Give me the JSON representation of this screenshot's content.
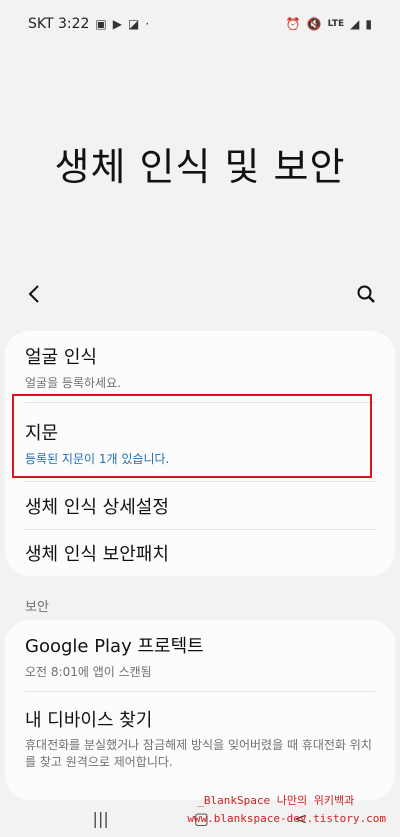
{
  "status_bar": {
    "carrier_time": "SKT 3:22",
    "left_icons": [
      "image-icon",
      "media-icon",
      "data-saver-icon",
      "dot-icon"
    ],
    "right_icons": [
      "alarm-icon",
      "mute-icon",
      "lte-signal-icon",
      "battery-icon"
    ],
    "lte_label": "LTE"
  },
  "page": {
    "title": "생체 인식 및 보안"
  },
  "toolbar": {
    "back_icon": "back-chevron-icon",
    "search_icon": "search-icon"
  },
  "biometrics": {
    "items": [
      {
        "title": "얼굴 인식",
        "subtitle": "얼굴을 등록하세요."
      },
      {
        "title": "지문",
        "subtitle": "등록된 지문이 1개 있습니다."
      },
      {
        "title": "생체 인식 상세설정"
      },
      {
        "title": "생체 인식 보안패치"
      }
    ]
  },
  "security": {
    "section_label": "보안",
    "items": [
      {
        "title": "Google Play 프로텍트",
        "subtitle": "오전 8:01에 앱이 스캔됨"
      },
      {
        "title": "내 디바이스 찾기",
        "subtitle": "휴대전화를 분실했거나 잠금해제 방식을 잊어버렸을 때 휴대전화 위치를 찾고 원격으로 제어합니다."
      }
    ]
  },
  "watermark": {
    "line1": "_BlankSpace 나만의 위키백과",
    "line2": "www.blankspace-dev.tistory.com"
  },
  "colors": {
    "highlight_border": "#e0141e",
    "link_blue": "#1f6fb5",
    "background": "#f2f2f2"
  }
}
